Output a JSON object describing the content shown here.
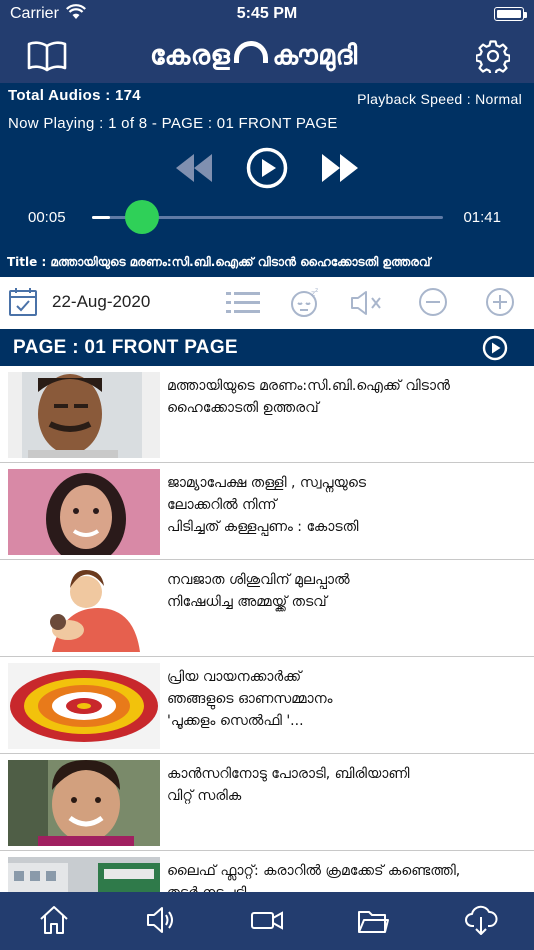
{
  "status_bar": {
    "carrier": "Carrier",
    "time": "5:45 PM"
  },
  "header": {
    "logo_text_left": "കേരള",
    "logo_text_right": "കൗമുദി"
  },
  "player": {
    "total_audios": "Total Audios :  174",
    "playback_speed": "Playback Speed : Normal",
    "now_playing": "Now Playing :  1 of 8 - PAGE :  01 FRONT PAGE",
    "current_time": "00:05",
    "total_time": "01:41",
    "progress_fraction": 0.05,
    "title": "Title : മത്തായിയുടെ മരണം:സി.ബി.ഐക്ക് വിടാൻ ഹൈക്കോടതി ഉത്തരവ്"
  },
  "toolbar": {
    "date": "22-Aug-2020"
  },
  "section": {
    "label": "PAGE : 01 FRONT PAGE"
  },
  "articles": [
    {
      "title": "മത്തായിയുടെ മരണം:സി.ബി.ഐക്ക് വിടാൻ\nഹൈക്കോടതി ഉത്തരവ്"
    },
    {
      "title": "ജാമ്യാപേക്ഷ തള്ളി , സ്വപ്നയുടെ\nലോക്കറിൽ നിന്ന്\nപിടിച്ചത് കള്ളപ്പണം  : കോടതി"
    },
    {
      "title": "നവജാത ശിശുവിന് മുലപ്പാൽ\nനിഷേധിച്ച അമ്മയ്ക്ക് തടവ്"
    },
    {
      "title": "പ്രിയ വായനക്കാർക്ക്\nഞങ്ങളുടെ  ഓണസമ്മാനം\n'പൂക്കളം സെൽഫി '..."
    },
    {
      "title": "കാൻസറിനോടു പോരാടി, ബിരിയാണി\nവിറ്റ് സരിക"
    },
    {
      "title": "ലൈഫ് ഫ്ലാറ്റ്: കരാറിൽ ക്രമക്കേട് കണ്ടെത്തി,\nതുടർ നടപടി"
    }
  ],
  "colors": {
    "header": "#233d6f",
    "player": "#003163",
    "accent": "#2fd058"
  }
}
